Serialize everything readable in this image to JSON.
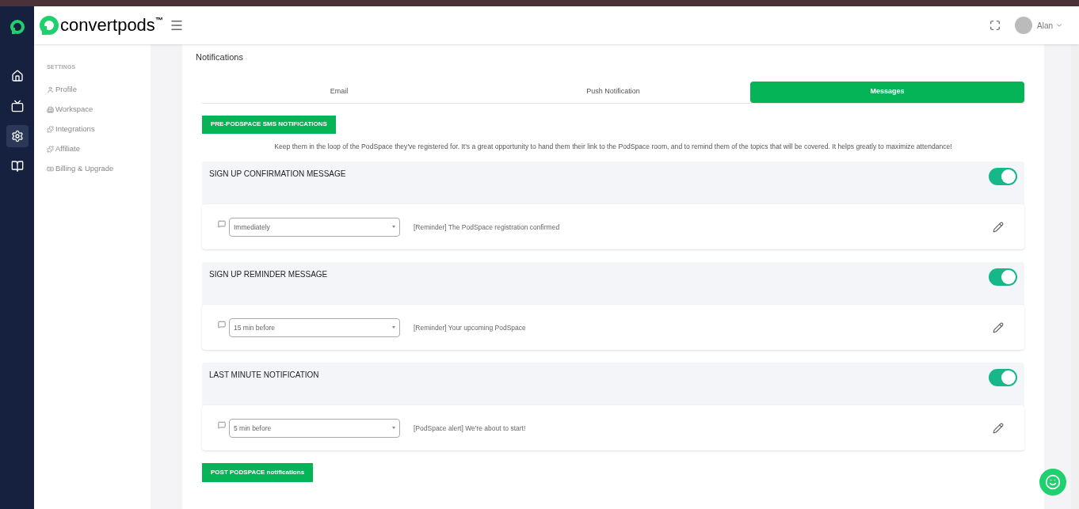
{
  "header": {
    "brand": "convertpods",
    "trademark": "™",
    "user": "Alan"
  },
  "rail": [
    {
      "selected": false
    },
    {
      "selected": false
    },
    {
      "selected": true
    },
    {
      "selected": false
    }
  ],
  "sidebar": {
    "heading": "SETTINGS",
    "items": [
      {
        "label": "Profile"
      },
      {
        "label": "Workspace"
      },
      {
        "label": "Integrations"
      },
      {
        "label": "Affiliate"
      },
      {
        "label": "Billing & Upgrade"
      }
    ]
  },
  "page": {
    "title": "Notifications",
    "tabs": [
      {
        "label": "Email",
        "selected": false
      },
      {
        "label": "Push Notification",
        "selected": false
      },
      {
        "label": "Messages",
        "selected": true
      }
    ],
    "pre_button": "PRE-PODSPACE SMS NOTIFICATIONS",
    "description": "Keep them in the loop of the PodSpace they've registered for. It's a great opportunity to hand them their link to the PodSpace room, and to remind them of the topics that will be covered. It helps greatly to maximize attendance!",
    "messages": [
      {
        "title": "SIGN UP CONFIRMATION MESSAGE",
        "on": true,
        "timing": "Immediately",
        "subject": "[Reminder] The PodSpace registration confirmed"
      },
      {
        "title": "SIGN UP REMINDER MESSAGE",
        "on": true,
        "timing": "15 min before",
        "subject": "[Reminder] Your upcoming PodSpace"
      },
      {
        "title": "LAST MINUTE NOTIFICATION",
        "on": true,
        "timing": "5 min before",
        "subject": "[PodSpace alert] We're about to start!"
      }
    ],
    "post_button": "POST PODSPACE notifications"
  }
}
